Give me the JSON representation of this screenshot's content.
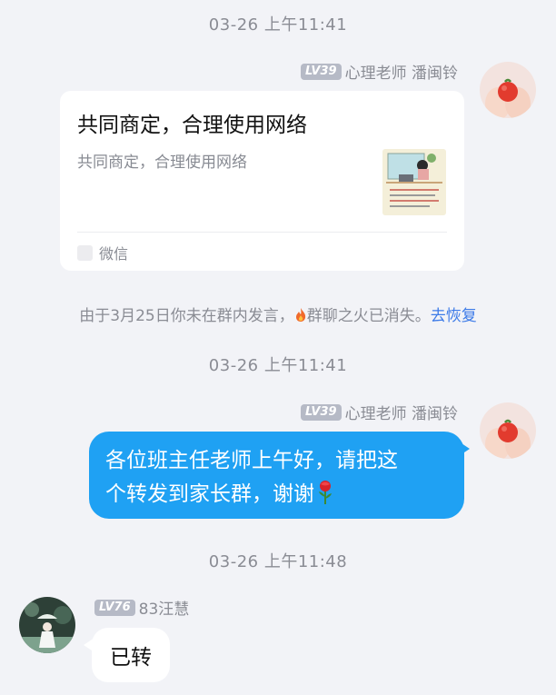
{
  "messages": {
    "ts1": "03-26 上午11:41",
    "ts2": "03-26 上午11:41",
    "ts3": "03-26 上午11:48",
    "teacher": {
      "level": "LV39",
      "name": "心理老师 潘闽铃"
    },
    "card": {
      "title": "共同商定，合理使用网络",
      "desc": "共同商定，合理使用网络",
      "source": "微信"
    },
    "notice": {
      "prefix": "由于3月25日你未在群内发言，",
      "middle": "群聊之火已消失。",
      "link": "去恢复"
    },
    "teacher_text_line1": "各位班主任老师上午好，请把这",
    "teacher_text_line2": "个转发到家长群，谢谢",
    "reply": {
      "level": "LV76",
      "name": "83汪慧",
      "text": "已转"
    }
  },
  "colors": {
    "background": "#f2f3f7",
    "bubble_blue": "#1fa1f3",
    "link": "#3d7be8",
    "meta_text": "#8a8c94"
  },
  "icons": [
    "fire-icon",
    "rose-icon",
    "wechat-source-icon"
  ]
}
